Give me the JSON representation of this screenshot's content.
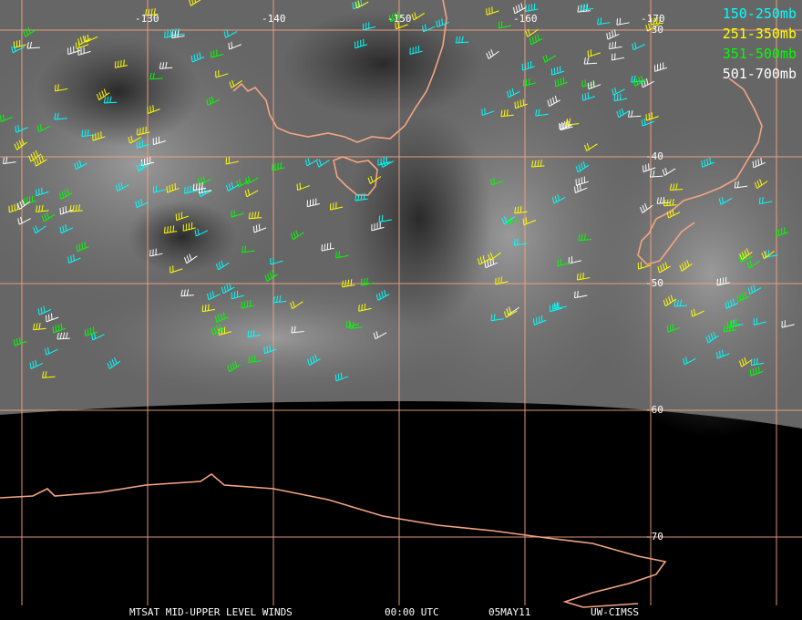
{
  "legend": [
    {
      "label": "150-250mb",
      "color": "#00ffff"
    },
    {
      "label": "251-350mb",
      "color": "#ffff00"
    },
    {
      "label": "351-500mb",
      "color": "#00ff00"
    },
    {
      "label": "501-700mb",
      "color": "#ffffff"
    }
  ],
  "longitude_labels": [
    "-130",
    "-140",
    "-150",
    "-160",
    "-170"
  ],
  "latitude_labels": [
    "-30",
    "-40",
    "-50",
    "-60",
    "-70"
  ],
  "footer": {
    "product": "MTSAT MID-UPPER LEVEL WINDS",
    "time": "00:00 UTC",
    "date": "05MAY11",
    "source": "UW-CIMSS"
  },
  "colors": {
    "coastline": "#f4a582",
    "gridline": "#f4a582",
    "background": "#000000"
  }
}
